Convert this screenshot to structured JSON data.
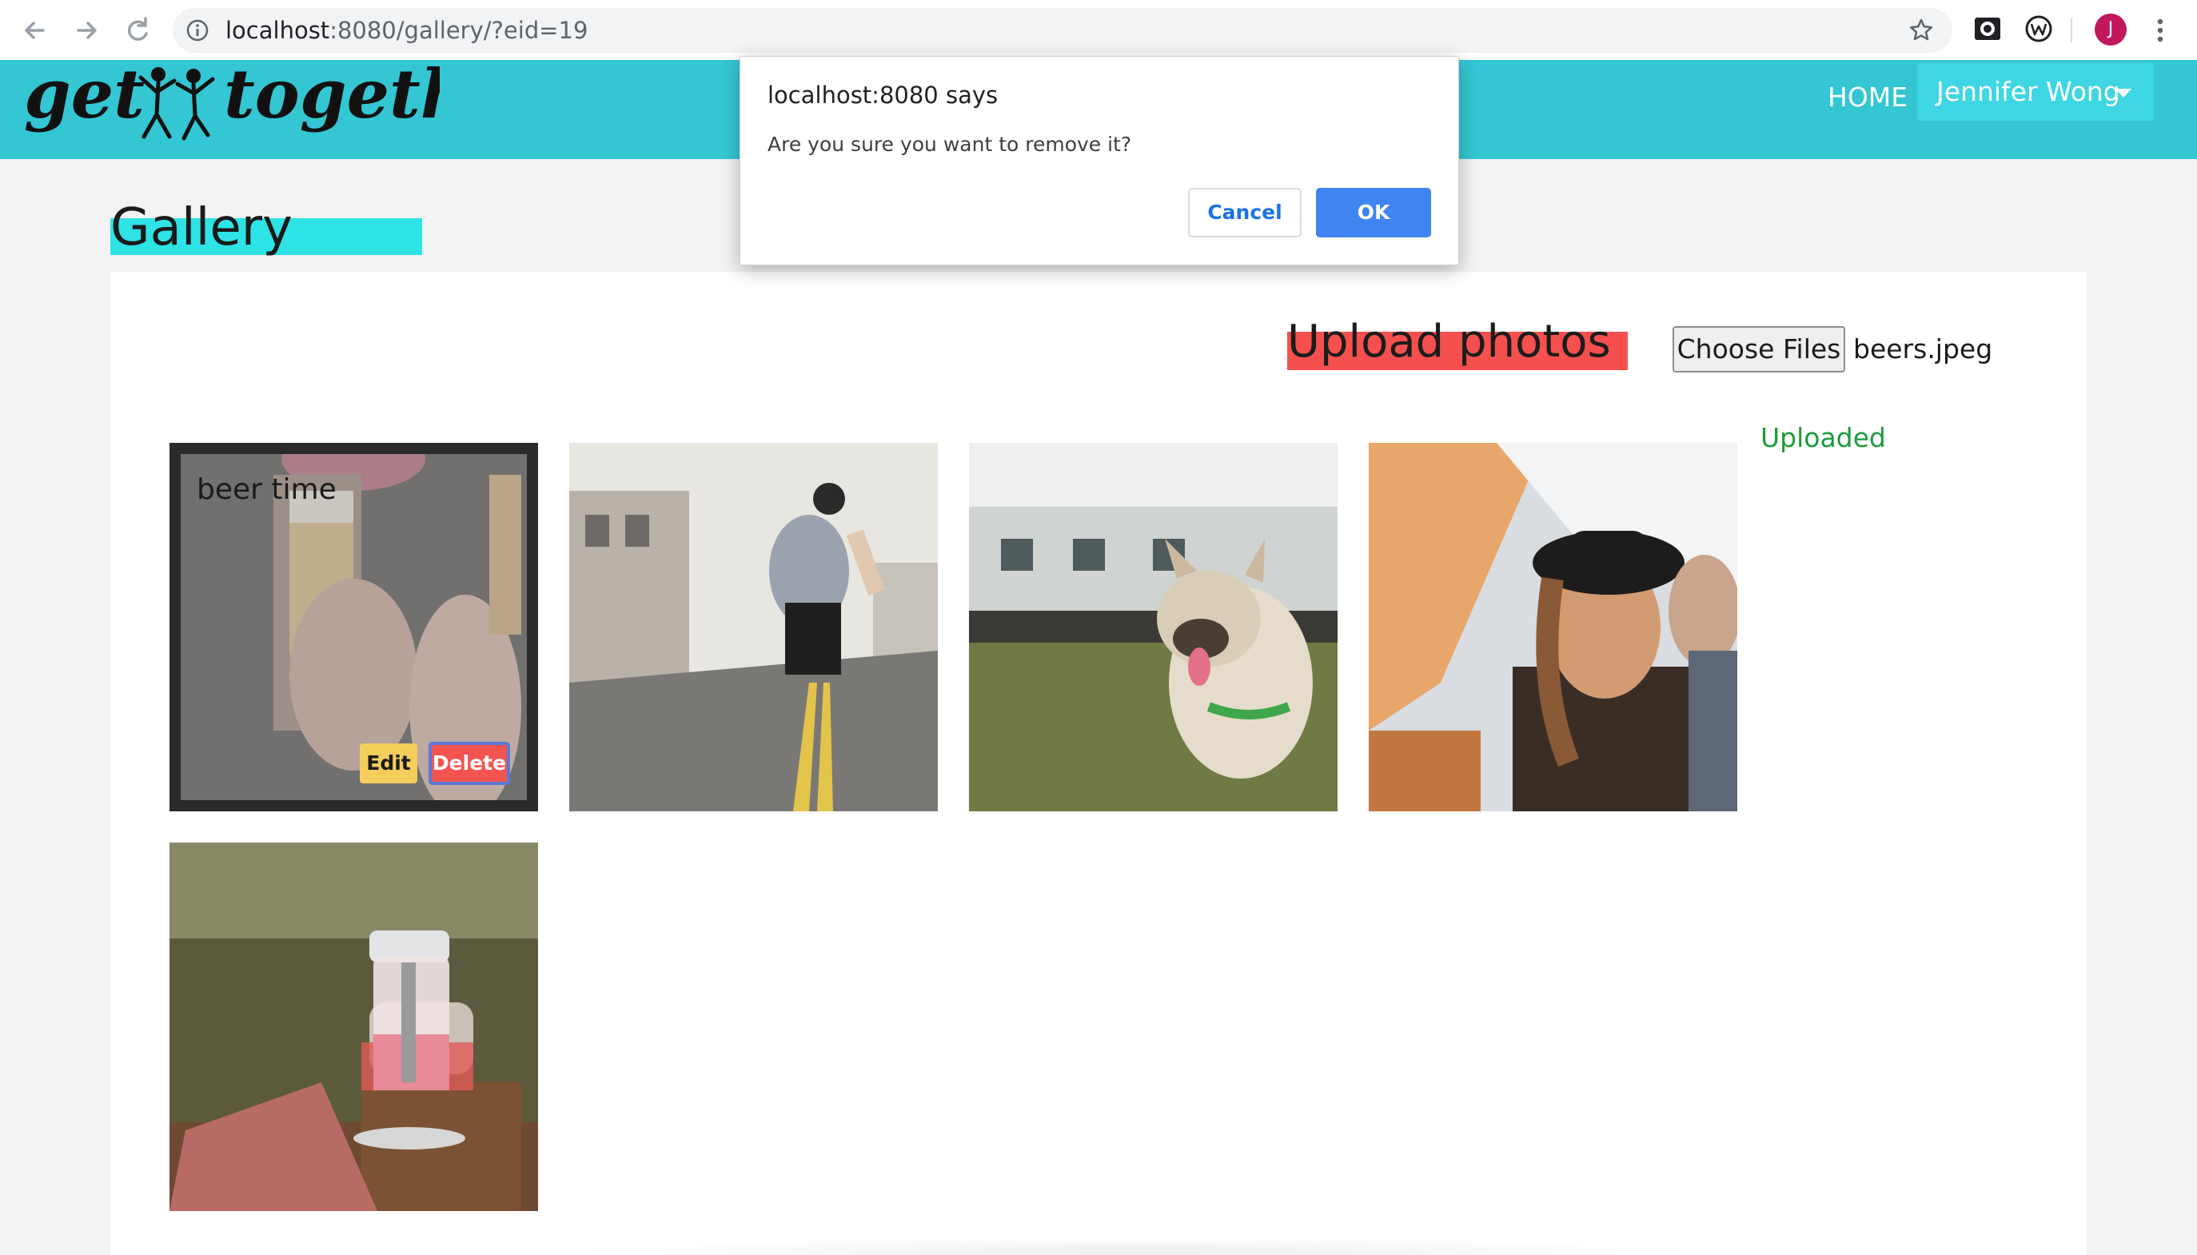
{
  "browser": {
    "url_host": "localhost",
    "url_rest": ":8080/gallery/?eid=19",
    "avatar_letter": "J"
  },
  "navbar": {
    "logo_left": "get",
    "logo_right": "together",
    "home_label": "HOME",
    "user_label": "Jennifer Wong"
  },
  "page": {
    "title": "Gallery",
    "upload_title": "Upload photos",
    "choose_files_label": "Choose Files",
    "file_name": "beers.jpeg",
    "upload_status": "Uploaded"
  },
  "gallery": {
    "photos": [
      {
        "subject": "beer",
        "caption": "beer time",
        "edit_label": "Edit",
        "delete_label": "Delete"
      },
      {
        "subject": "street-jump"
      },
      {
        "subject": "bulldog"
      },
      {
        "subject": "friends-laughing"
      },
      {
        "subject": "picnic-pitcher"
      }
    ]
  },
  "dialog": {
    "title": "localhost:8080 says",
    "message": "Are you sure you want to remove it?",
    "cancel_label": "Cancel",
    "ok_label": "OK"
  },
  "colors": {
    "navbar": "#34c6d3",
    "user_button": "#3ed6e2",
    "gallery_highlight": "#2ee3e6",
    "upload_highlight": "#f5504e",
    "uploaded_text": "#1e9b3a",
    "ok_button": "#3f84f1",
    "edit_button": "#f5cd5a",
    "delete_button": "#f45450"
  }
}
